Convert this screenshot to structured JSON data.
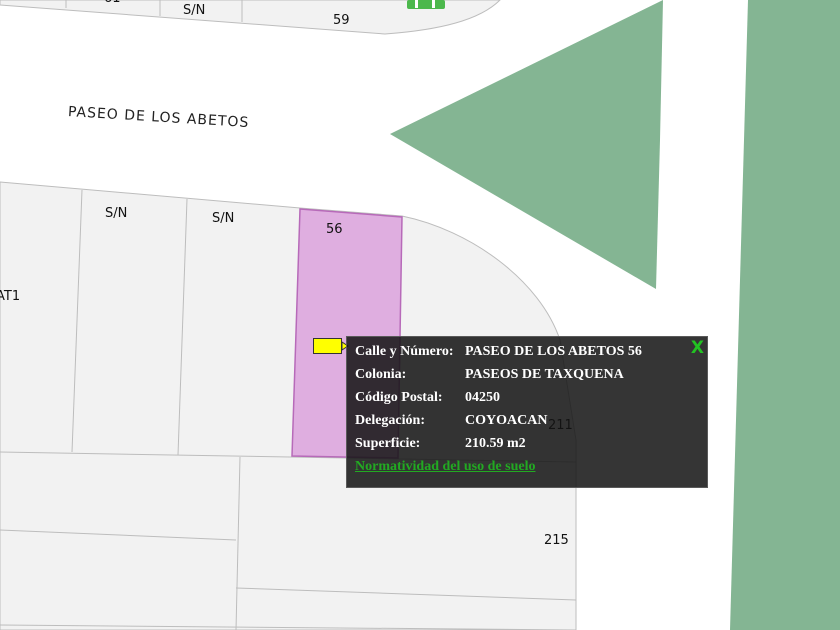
{
  "map": {
    "colors": {
      "background": "#ffffff",
      "lot_fill": "#f2f2f2",
      "lot_border": "#bdbdbd",
      "selected_fill": "#dfaee0",
      "selected_border": "#b76ab9",
      "green_area": "#84b593",
      "marker": "#ffff00",
      "popup_bg": "#141414",
      "link": "#22aa22"
    },
    "street_name": "PASEO DE LOS ABETOS",
    "lot_labels": {
      "top_partial": "61",
      "top_sn": "S/N",
      "top_59": "59",
      "sn_1": "S/N",
      "sn_2": "S/N",
      "selected": "56",
      "left_partial": "AT1",
      "lot_211": "211",
      "lot_215": "215"
    },
    "marker_icon": "yellow-flag-icon",
    "top_icon": "green-sign-icon"
  },
  "popup": {
    "close_label": "X",
    "rows": [
      {
        "label": "Calle y Número:",
        "value": "PASEO DE LOS ABETOS 56"
      },
      {
        "label": "Colonia:",
        "value": "PASEOS DE TAXQUENA"
      },
      {
        "label": "Código Postal:",
        "value": "04250"
      },
      {
        "label": "Delegación:",
        "value": "COYOACAN"
      },
      {
        "label": "Superficie:",
        "value": "210.59 m2"
      }
    ],
    "link_label": "Normatividad del uso de suelo"
  }
}
